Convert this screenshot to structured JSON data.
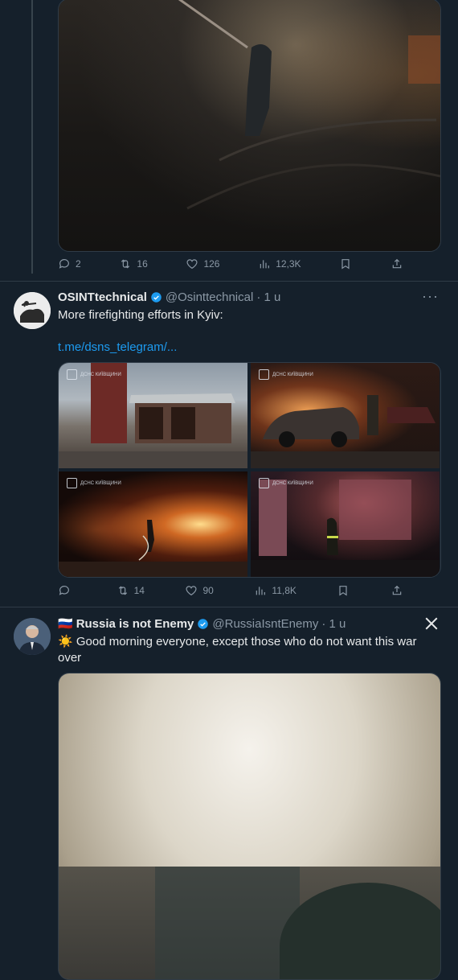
{
  "post1": {
    "stats": {
      "replies": "2",
      "reposts": "16",
      "likes": "126",
      "views": "12,3K"
    }
  },
  "post2": {
    "display_name": "OSINTtechnical",
    "handle": "@Osinttechnical",
    "time": "· 1 u",
    "text": "More firefighting efforts in Kyiv:",
    "link": "t.me/dsns_telegram/...",
    "watermark": "ДСНС КИЇВЩИНИ",
    "stats": {
      "replies": "",
      "reposts": "14",
      "likes": "90",
      "views": "11,8K"
    }
  },
  "post3": {
    "flag": "🇷🇺",
    "display_name": "Russia is not Enemy",
    "handle": "@RussiaIsntEnemy",
    "time": "· 1 u",
    "sun": "☀️",
    "text": "Good morning everyone, except those who do not want this war over"
  },
  "icons": [
    "reply-icon",
    "repost-icon",
    "like-icon",
    "views-icon",
    "bookmark-icon",
    "share-icon",
    "verified-icon",
    "more-icon",
    "x-logo-icon"
  ],
  "colors": {
    "background": "#15202b",
    "accent": "#1d9bf0",
    "muted": "#8b98a5",
    "text": "#e7e9ea"
  }
}
